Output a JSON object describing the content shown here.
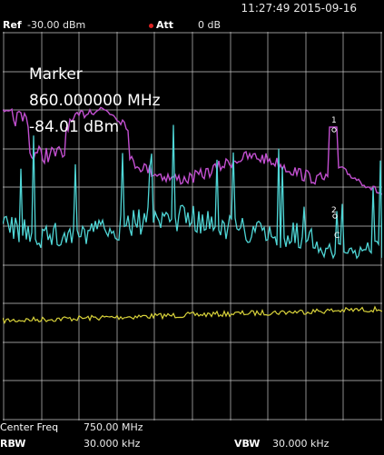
{
  "header": {
    "timestamp": "11:27:49 2015-09-16"
  },
  "status": {
    "ref_label": "Ref",
    "ref_value": "-30.00 dBm",
    "att_label": "Att",
    "att_value": "0 dB"
  },
  "marker": {
    "title": "Marker",
    "frequency": "860.000000 MHz",
    "level": "-84.01 dBm",
    "labels": [
      "1",
      "2",
      "C"
    ]
  },
  "footer": {
    "center_freq_label": "Center Freq",
    "center_freq_value": "750.00 MHz",
    "rbw_label": "RBW",
    "rbw_value": "30.000 kHz",
    "vbw_label": "VBW",
    "vbw_value": "30.000 kHz"
  },
  "colors": {
    "trace_cyan": "#4fd6d6",
    "trace_magenta": "#c24fd0",
    "trace_yellow": "#d8d23a",
    "grid": "#c8c8c8",
    "background": "#000000",
    "att_indicator": "#dd2222"
  }
}
